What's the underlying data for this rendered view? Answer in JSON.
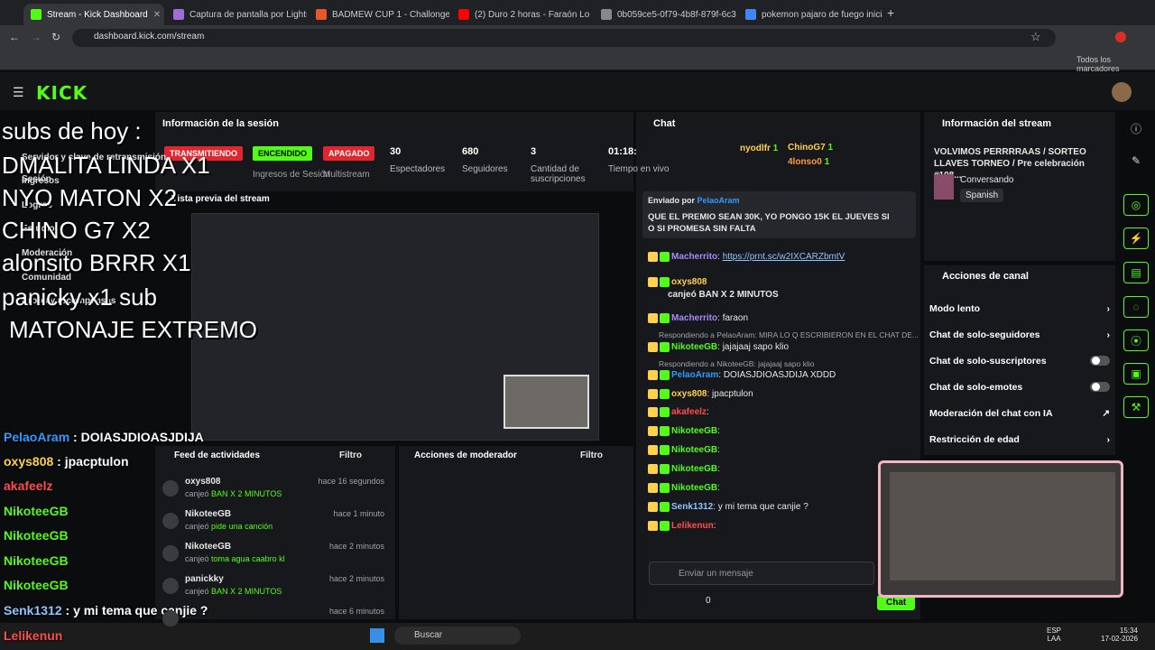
{
  "tabs": [
    {
      "label": "Stream - Kick Dashboard",
      "color": "#53fc18"
    },
    {
      "label": "Captura de pantalla por Lightsh",
      "color": "#a06cd5"
    },
    {
      "label": "BADMEW CUP 1 - Challonge",
      "color": "#e8562a"
    },
    {
      "label": "(2) Duro 2 horas - Faraón Lo",
      "color": "#ff0000"
    },
    {
      "label": "0b059ce5-0f79-4b8f-879f-6c30",
      "color": "#888888"
    },
    {
      "label": "pokemon pajaro de fuego inicial",
      "color": "#4285f4"
    }
  ],
  "address": "dashboard.kick.com/stream",
  "bookmarks": "Todos los marcadores",
  "logo": "KICK",
  "session": {
    "title": "Información de la sesión",
    "live": "TRANSMITIENDO",
    "on": "ENCENDIDO",
    "off": "APAGADO",
    "multistream": "Multistream",
    "ingress": "Ingresos de Sesión",
    "stats": [
      {
        "v": "30",
        "l": "Espectadores"
      },
      {
        "v": "680",
        "l": "Seguidores"
      },
      {
        "v": "3",
        "l": "Cantidad de suscripciones"
      },
      {
        "v": "01:18:",
        "l": "Tiempo en vivo"
      }
    ]
  },
  "sidebar": [
    "Sesión",
    "Servidor y clave de retransmisión",
    "Ingresos",
    "Logros",
    "Estudio",
    "Moderación",
    "Comunidad",
    "Drops y recompensas"
  ],
  "preview_title": "Vista previa del stream",
  "overlay": {
    "lines": [
      "subs de hoy :",
      "DMALITA LINDA X1",
      "NYO MATON X2",
      "CHINO G7 X2",
      "alonsito BRRR X1",
      "panicky x1 sub",
      "MATONAJE EXTREMO"
    ]
  },
  "overlay_chat": [
    {
      "user": "PelaoAram",
      "msg": "DOIASJDIOASJDIJA",
      "color": "#2f9bff"
    },
    {
      "user": "oxys808",
      "msg": "jpacptulon",
      "color": "#ffd24a"
    },
    {
      "user": "akafeelz",
      "msg": "",
      "color": "#ff4d4d"
    },
    {
      "user": "NikoteeGB",
      "msg": "",
      "color": "#53fc18"
    },
    {
      "user": "NikoteeGB",
      "msg": "",
      "color": "#53fc18"
    },
    {
      "user": "NikoteeGB",
      "msg": "",
      "color": "#53fc18"
    },
    {
      "user": "NikoteeGB",
      "msg": "",
      "color": "#53fc18"
    },
    {
      "user": "Senk1312",
      "msg": "y mi tema que canjie ?",
      "color": "#8ec5ff"
    },
    {
      "user": "Lelikenun",
      "msg": "",
      "color": "#ff4d4d"
    }
  ],
  "feed": {
    "title": "Feed de actividades",
    "filter": "Filtro",
    "mod_title": "Acciones de moderador",
    "items": [
      {
        "user": "oxys808",
        "time": "hace 16 segundos",
        "action": "canjeó",
        "reward": "BAN X 2 MINUTOS"
      },
      {
        "user": "NikoteeGB",
        "time": "hace 1 minuto",
        "action": "canjeó",
        "reward": "pide una canción"
      },
      {
        "user": "NikoteeGB",
        "time": "hace 2 minutos",
        "action": "canjeó",
        "reward": "toma agua caabro kl"
      },
      {
        "user": "panickky",
        "time": "hace 2 minutos",
        "action": "canjeó",
        "reward": "BAN X 2 MINUTOS"
      },
      {
        "user": "",
        "time": "hace 6 minutos",
        "action": "",
        "reward": ""
      }
    ]
  },
  "chat": {
    "title": "Chat",
    "top": [
      {
        "user": "nyodlfr",
        "n": "1"
      },
      {
        "user": "ChinoG7",
        "n": "1"
      },
      {
        "user": "4lonso0",
        "n": "1"
      }
    ],
    "pinned_by": "Enviado por",
    "pinned_user": "PelaoAram",
    "pinned_msg": "QUE EL PREMIO SEAN 30K, YO PONGO 15K EL JUEVES SI O SI PROMESA SIN FALTA",
    "lines": [
      {
        "user": "Macherrito",
        "msg": "https://prnt.sc/w2IXCARZbmtV",
        "color": "#a78bfa",
        "link": true
      },
      {
        "user": "oxys808",
        "msg": "canjeó BAN X 2 MINUTOS",
        "color": "#ffd24a",
        "reward": true
      },
      {
        "user": "Macherrito",
        "msg": "faraon",
        "color": "#a78bfa"
      },
      {
        "reply": "Respondiendo a PelaoAram: MIRA LO Q ESCRIBIERON EN EL CHAT DE..."
      },
      {
        "user": "NikoteeGB",
        "msg": "jajajaaj sapo klio",
        "color": "#53fc18"
      },
      {
        "reply": "Respondiendo a NikoteeGB: jajajaaj sapo klio"
      },
      {
        "user": "PelaoAram",
        "msg": "DOIASJDIOASJDIJA XDDD",
        "color": "#2f9bff"
      },
      {
        "user": "oxys808",
        "msg": "jpacptulon",
        "color": "#ffd24a"
      },
      {
        "user": "akafeelz",
        "msg": "",
        "color": "#ff4d4d"
      },
      {
        "user": "NikoteeGB",
        "msg": "",
        "color": "#53fc18"
      },
      {
        "user": "NikoteeGB",
        "msg": "",
        "color": "#53fc18"
      },
      {
        "user": "NikoteeGB",
        "msg": "",
        "color": "#53fc18"
      },
      {
        "user": "NikoteeGB",
        "msg": "",
        "color": "#53fc18"
      },
      {
        "user": "Senk1312",
        "msg": "y mi tema que canjie ?",
        "color": "#8ec5ff"
      },
      {
        "user": "Lelikenun",
        "msg": "",
        "color": "#ff4d4d"
      }
    ],
    "placeholder": "Enviar un mensaje",
    "points": "0",
    "send": "Chat"
  },
  "info": {
    "title": "Información del stream",
    "stream_title": "VOLVIMOS PERRRRAAS / SORTEO LLAVES TORNEO / Pre celebración #108...",
    "category": "Conversando",
    "lang": "Spanish"
  },
  "actions": {
    "title": "Acciones de canal",
    "items": [
      {
        "label": "Modo lento",
        "kind": "arrow"
      },
      {
        "label": "Chat de solo-seguidores",
        "kind": "arrow"
      },
      {
        "label": "Chat de solo-suscriptores",
        "kind": "toggle"
      },
      {
        "label": "Chat de solo-emotes",
        "kind": "toggle"
      },
      {
        "label": "Moderación del chat con IA",
        "kind": "ext"
      },
      {
        "label": "Restricción de edad",
        "kind": "arrow"
      }
    ]
  },
  "taskbar": {
    "search": "Buscar",
    "lang1": "ESP",
    "lang2": "LAA",
    "time": "15:34",
    "date": "17-02-2026"
  }
}
